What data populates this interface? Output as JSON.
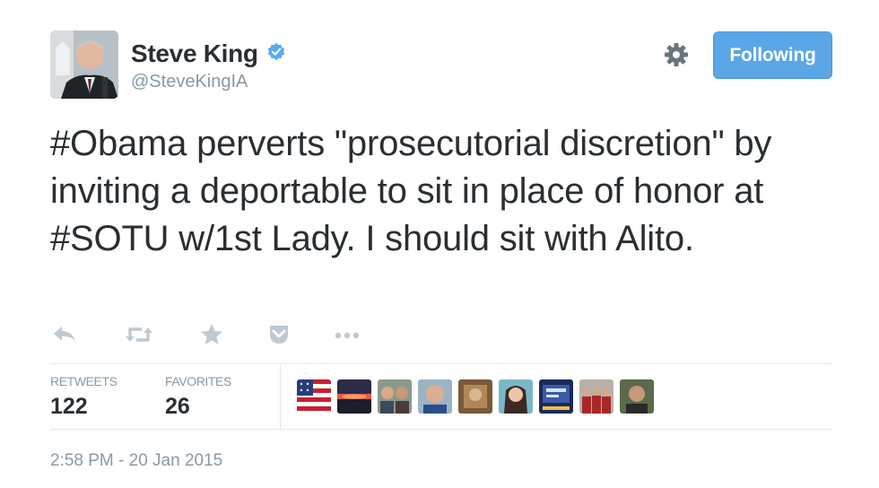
{
  "user": {
    "display_name": "Steve King",
    "handle": "@SteveKingIA",
    "verified": true
  },
  "header": {
    "follow_label": "Following",
    "settings_icon": "gear-icon"
  },
  "tweet": {
    "text": "#Obama perverts \"prosecutorial discretion\" by inviting a deportable to sit in place of honor at #SOTU w/1st Lady. I should sit with Alito."
  },
  "actions": [
    {
      "name": "reply-icon"
    },
    {
      "name": "retweet-icon"
    },
    {
      "name": "favorite-star-icon"
    },
    {
      "name": "pocket-save-icon"
    },
    {
      "name": "more-ellipsis-icon"
    }
  ],
  "stats": {
    "retweets_label": "RETWEETS",
    "retweets_count": "122",
    "favorites_label": "FAVORITES",
    "favorites_count": "26"
  },
  "faces": [
    {
      "name": "avatar-flag"
    },
    {
      "name": "avatar-sunset"
    },
    {
      "name": "avatar-two-men"
    },
    {
      "name": "avatar-bald-man"
    },
    {
      "name": "avatar-sepia"
    },
    {
      "name": "avatar-woman"
    },
    {
      "name": "avatar-screen"
    },
    {
      "name": "avatar-group"
    },
    {
      "name": "avatar-man"
    }
  ],
  "meta": {
    "timestamp": "2:58 PM - 20 Jan 2015"
  },
  "colors": {
    "follow_button": "#5aa6e6",
    "verified_badge": "#55acee",
    "muted_text": "#8899a6",
    "icon_gray": "#bfc9d2",
    "body_text": "#292f33"
  }
}
